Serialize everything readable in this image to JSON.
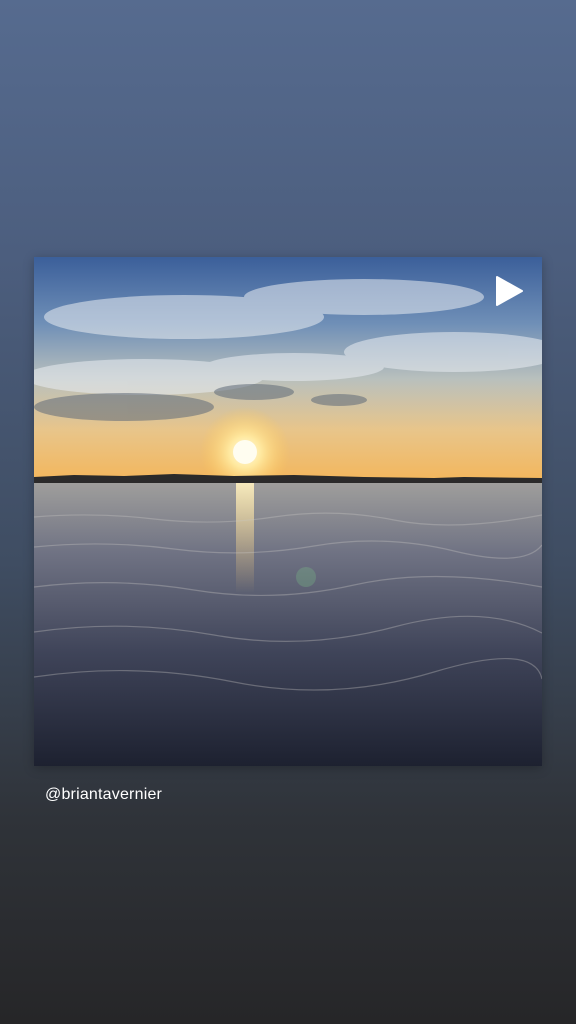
{
  "story": {
    "attribution_handle": "@briantavernier"
  },
  "post": {
    "media_type": "video",
    "play_icon": "play-icon"
  },
  "colors": {
    "background_top": "#566b8f",
    "background_bottom": "#262628",
    "text": "#ffffff"
  }
}
